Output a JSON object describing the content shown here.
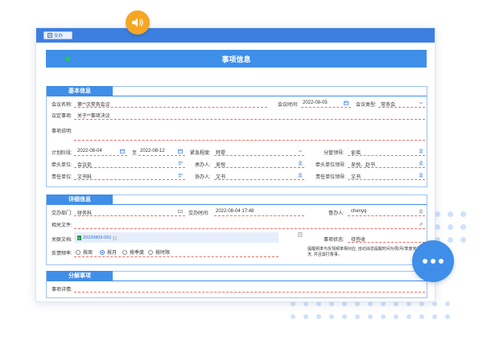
{
  "toolbar": {
    "button_label": "交办"
  },
  "page_title": "事项信息",
  "basic": {
    "header": "基本信息",
    "meeting_name_label": "会议名称:",
    "meeting_name_value": "第**次常务会议",
    "meeting_time_label": "会议时间:",
    "meeting_time_value": "2022-08-05",
    "meeting_type_label": "会议类型:",
    "meeting_type_value": "常务会",
    "topic_label": "议定事项:",
    "topic_value": "关于**事项决议",
    "desc_label": "事项说明:",
    "plan_label": "计划阶段:",
    "plan_start": "2022-08-04",
    "plan_to": "至",
    "plan_end": "2022-08-12",
    "urgency_label": "紧急程度:",
    "urgency_value": "特提",
    "leader_label": "分管领导:",
    "leader_value": "俞瑶",
    "lead_unit_label": "牵头单位:",
    "lead_unit_value": "会议处",
    "handler_label": "承办人:",
    "handler_value": "吴悦",
    "lead_unit_leader_label": "牵头单位领导:",
    "lead_unit_leader_value": "吴悦、赵书",
    "resp_unit_label": "责任单位:",
    "resp_unit_value": "文书科",
    "assist_label": "协办人:",
    "assist_value": "文书",
    "resp_leader_label": "责任单位领导:",
    "resp_leader_value": "文书"
  },
  "detail": {
    "header": "详细信息",
    "dept_label": "交办部门:",
    "dept_value": "财务科",
    "assign_time_label": "交办时间:",
    "assign_time_value": "2022-08-04 17:48",
    "person_label": "督办人:",
    "person_value": "chenyq",
    "files_label": "相关文件:",
    "linked_doc_label": "关联文档:",
    "linked_doc_value": "20220803-001",
    "status_label": "事项状态:",
    "status_value": "待签收",
    "freq_label": "反馈频率:",
    "freq_options": [
      "按周",
      "按月",
      "按季度",
      "按时限"
    ],
    "note": "提醒频率与反馈频率相对应, 自动消息提醒时间为周/月/季度末前一天, 并且需打督事。"
  },
  "decompose": {
    "header": "分解事项",
    "detail_label": "事项详情:"
  }
}
